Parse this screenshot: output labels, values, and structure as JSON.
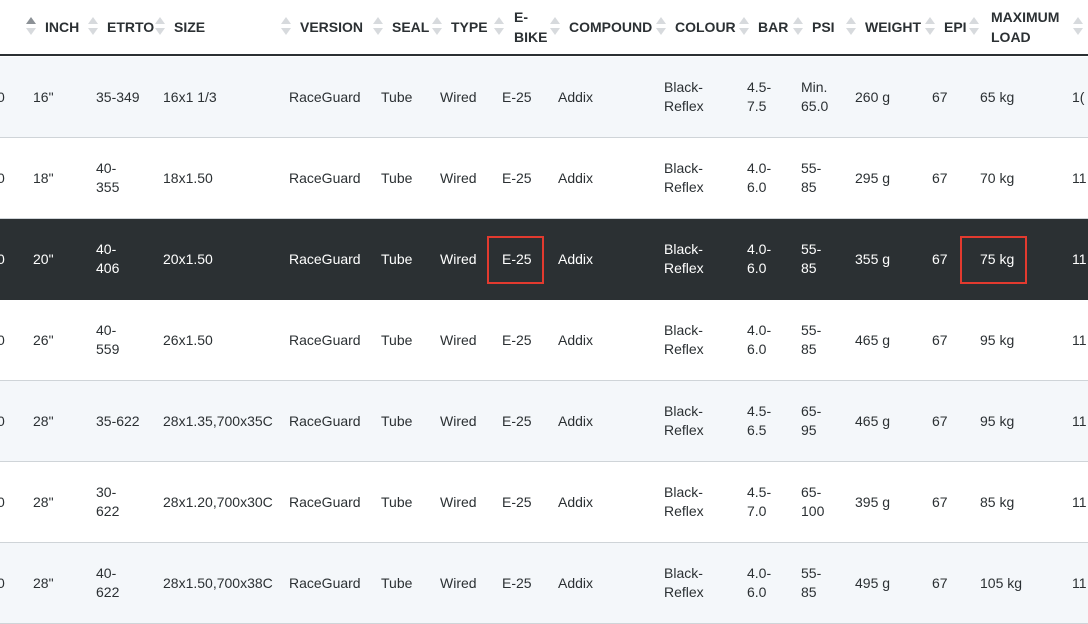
{
  "columns": {
    "edge": "",
    "inch": "INCH",
    "etrto": "ETRTO",
    "size": "SIZE",
    "version": "VERSION",
    "seal": "SEAL",
    "type": "TYPE",
    "ebike": "E-\nBIKE",
    "compound": "COMPOUND",
    "colour": "COLOUR",
    "bar": "BAR",
    "psi": "PSI",
    "weight": "WEIGHT",
    "epi": "EPI",
    "maxload": "MAXIMUM\nLOAD"
  },
  "sort_active_column": "inch",
  "rows": [
    {
      "edge": "0",
      "inch": "16\"",
      "etrto": "35-349",
      "size": "16x1 1/3",
      "version": "RaceGuard",
      "seal": "Tube",
      "type": "Wired",
      "ebike": "E-25",
      "compound": "Addix",
      "colour": "Black-\nReflex",
      "bar": "4.5-\n7.5",
      "psi": "Min.\n65.0",
      "weight": "260 g",
      "epi": "67",
      "maxload": "65 kg",
      "extra": "1("
    },
    {
      "edge": "0",
      "inch": "18\"",
      "etrto": "40-\n355",
      "size": "18x1.50",
      "version": "RaceGuard",
      "seal": "Tube",
      "type": "Wired",
      "ebike": "E-25",
      "compound": "Addix",
      "colour": "Black-\nReflex",
      "bar": "4.0-\n6.0",
      "psi": "55-\n85",
      "weight": "295 g",
      "epi": "67",
      "maxload": "70 kg",
      "extra": "11"
    },
    {
      "edge": "0",
      "inch": "20\"",
      "etrto": "40-\n406",
      "size": "20x1.50",
      "version": "RaceGuard",
      "seal": "Tube",
      "type": "Wired",
      "ebike": "E-25",
      "compound": "Addix",
      "colour": "Black-\nReflex",
      "bar": "4.0-\n6.0",
      "psi": "55-\n85",
      "weight": "355 g",
      "epi": "67",
      "maxload": "75 kg",
      "extra": "11",
      "selected": true
    },
    {
      "edge": "0",
      "inch": "26\"",
      "etrto": "40-\n559",
      "size": "26x1.50",
      "version": "RaceGuard",
      "seal": "Tube",
      "type": "Wired",
      "ebike": "E-25",
      "compound": "Addix",
      "colour": "Black-\nReflex",
      "bar": "4.0-\n6.0",
      "psi": "55-\n85",
      "weight": "465 g",
      "epi": "67",
      "maxload": "95 kg",
      "extra": "11"
    },
    {
      "edge": "0",
      "inch": "28\"",
      "etrto": "35-622",
      "size": "28x1.35,700x35C",
      "version": "RaceGuard",
      "seal": "Tube",
      "type": "Wired",
      "ebike": "E-25",
      "compound": "Addix",
      "colour": "Black-\nReflex",
      "bar": "4.5-\n6.5",
      "psi": "65-\n95",
      "weight": "465 g",
      "epi": "67",
      "maxload": "95 kg",
      "extra": "11"
    },
    {
      "edge": "0",
      "inch": "28\"",
      "etrto": "30-\n622",
      "size": "28x1.20,700x30C",
      "version": "RaceGuard",
      "seal": "Tube",
      "type": "Wired",
      "ebike": "E-25",
      "compound": "Addix",
      "colour": "Black-\nReflex",
      "bar": "4.5-\n7.0",
      "psi": "65-\n100",
      "weight": "395 g",
      "epi": "67",
      "maxload": "85 kg",
      "extra": "11"
    },
    {
      "edge": "0",
      "inch": "28\"",
      "etrto": "40-\n622",
      "size": "28x1.50,700x38C",
      "version": "RaceGuard",
      "seal": "Tube",
      "type": "Wired",
      "ebike": "E-25",
      "compound": "Addix",
      "colour": "Black-\nReflex",
      "bar": "4.0-\n6.0",
      "psi": "55-\n85",
      "weight": "495 g",
      "epi": "67",
      "maxload": "105 kg",
      "extra": "11"
    }
  ],
  "highlights": [
    {
      "row": 2,
      "column": "ebike"
    },
    {
      "row": 2,
      "column": "maxload"
    }
  ],
  "colors": {
    "header_text": "#2b3033",
    "row_alt": "#f4f7fa",
    "row_selected": "#2b3033",
    "highlight_border": "#e23a2f",
    "sort_inactive": "#d7dadd",
    "sort_active": "#8c9196"
  }
}
